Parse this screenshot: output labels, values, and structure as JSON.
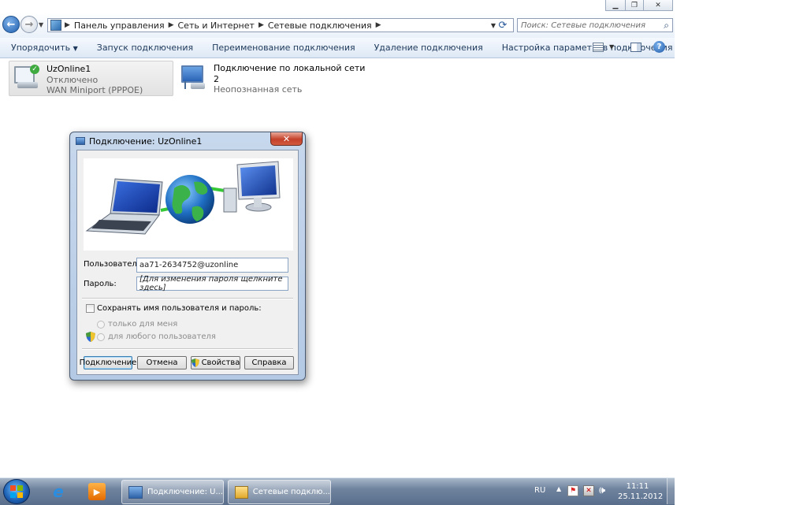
{
  "address": {
    "crumbs": [
      "Панель управления",
      "Сеть и Интернет",
      "Сетевые подключения"
    ],
    "search_placeholder": "Поиск: Сетевые подключения"
  },
  "toolbar": {
    "organize": "Упорядочить",
    "start_connection": "Запуск подключения",
    "rename_connection": "Переименование подключения",
    "delete_connection": "Удаление подключения",
    "settings": "Настройка параметров подключения"
  },
  "connections": [
    {
      "name": "UzOnline1",
      "status": "Отключено",
      "device": "WAN Miniport (PPPOE)"
    },
    {
      "name": "Подключение по локальной сети",
      "status": "2",
      "device": "Неопознанная сеть"
    }
  ],
  "dialog": {
    "title": "Подключение: UzOnline1",
    "close": "✕",
    "user_label": "Пользователь:",
    "user_value": "aa71-2634752@uzonline",
    "password_label": "Пароль:",
    "password_value": "[Для изменения пароля щелкните здесь]",
    "save_label": "Сохранять имя пользователя и пароль:",
    "only_me": "только для меня",
    "any_user": "для любого пользователя",
    "btn_connect": "Подключение",
    "btn_cancel": "Отмена",
    "btn_properties": "Свойства",
    "btn_help": "Справка"
  },
  "taskbar": {
    "items": [
      "Подключение: U...",
      "Сетевые подклю..."
    ],
    "lang": "RU",
    "time": "11:11",
    "date": "25.11.2012"
  },
  "colors": {
    "accent": "#1e395b",
    "taskbar": "#596e8b",
    "dialog_frame": "#b4c9e4",
    "close_red": "#c4402a"
  }
}
